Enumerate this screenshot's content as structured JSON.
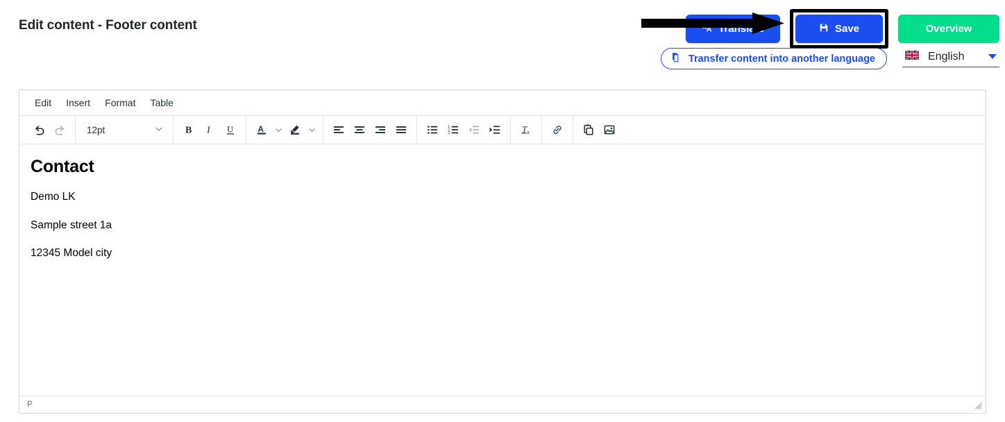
{
  "header": {
    "title": "Edit content - Footer content",
    "actions": [
      {
        "label": "Translate",
        "icon": "translate-icon",
        "color": "#1b4ef0"
      },
      {
        "label": "Save",
        "icon": "save-icon",
        "color": "#1b4ef0"
      },
      {
        "label": "Overview",
        "icon": "",
        "color": "#04dd8a"
      }
    ]
  },
  "subheader": {
    "transfer_label": "Transfer content into another language",
    "transfer_icon": "copy-document-icon",
    "language": {
      "selected": "English",
      "flag": "uk-flag-icon"
    }
  },
  "annotation": {
    "type": "arrow",
    "color": "#000000",
    "points_to": "Save",
    "highlight_target": "save-button",
    "highlight_color": "#000000"
  },
  "editor": {
    "menubar": [
      {
        "label": "Edit"
      },
      {
        "label": "Insert"
      },
      {
        "label": "Format"
      },
      {
        "label": "Table"
      }
    ],
    "toolbar": {
      "undo": "undo-icon",
      "redo": "redo-icon",
      "fontsize": "12pt",
      "bold": "bold-icon",
      "italic": "italic-icon",
      "underline": "underline-icon",
      "text_color": "text-color-icon",
      "highlight_color": "highlight-color-icon",
      "align_left": "align-left-icon",
      "align_center": "align-center-icon",
      "align_right": "align-right-icon",
      "align_justify": "align-justify-icon",
      "bullet_list": "bullet-list-icon",
      "numbered_list": "numbered-list-icon",
      "decrease_indent": "decrease-indent-icon",
      "increase_indent": "increase-indent-icon",
      "clear_formatting": "clear-formatting-icon",
      "link": "link-icon",
      "paste": "paste-icon",
      "image": "image-icon"
    },
    "content": {
      "heading": "Contact",
      "paragraphs": [
        "Demo LK",
        "Sample street 1a",
        "12345 Model city"
      ]
    },
    "statusbar": {
      "element_path": "P",
      "resize": "resize-handle-icon"
    }
  }
}
